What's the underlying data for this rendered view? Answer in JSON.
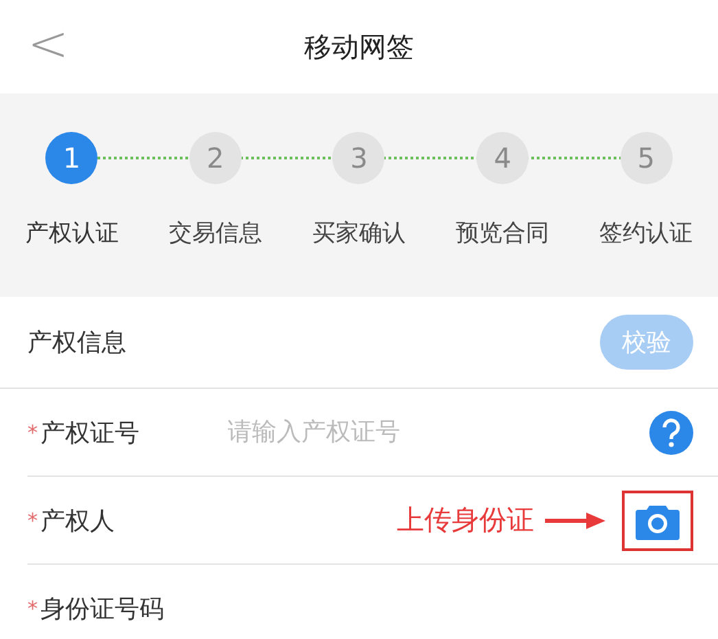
{
  "header": {
    "back": "<",
    "title": "移动网签"
  },
  "steps": [
    {
      "number": "1",
      "label": "产权认证",
      "selected": true
    },
    {
      "number": "2",
      "label": "交易信息",
      "selected": false
    },
    {
      "number": "3",
      "label": "买家确认",
      "selected": false
    },
    {
      "number": "4",
      "label": "预览合同",
      "selected": false
    },
    {
      "number": "5",
      "label": "签约认证",
      "selected": false
    }
  ],
  "section": {
    "title": "产权信息",
    "button": "校验"
  },
  "rows": [
    {
      "kind": "input",
      "marker": "*",
      "label": "产权证号",
      "placeholder": "请输入产权证号"
    },
    {
      "kind": "camera",
      "marker": "*",
      "label": "产权人"
    },
    {
      "kind": "plain",
      "marker": "*",
      "label": "身份证号码"
    }
  ],
  "annotation": {
    "text": "上传身份证"
  }
}
